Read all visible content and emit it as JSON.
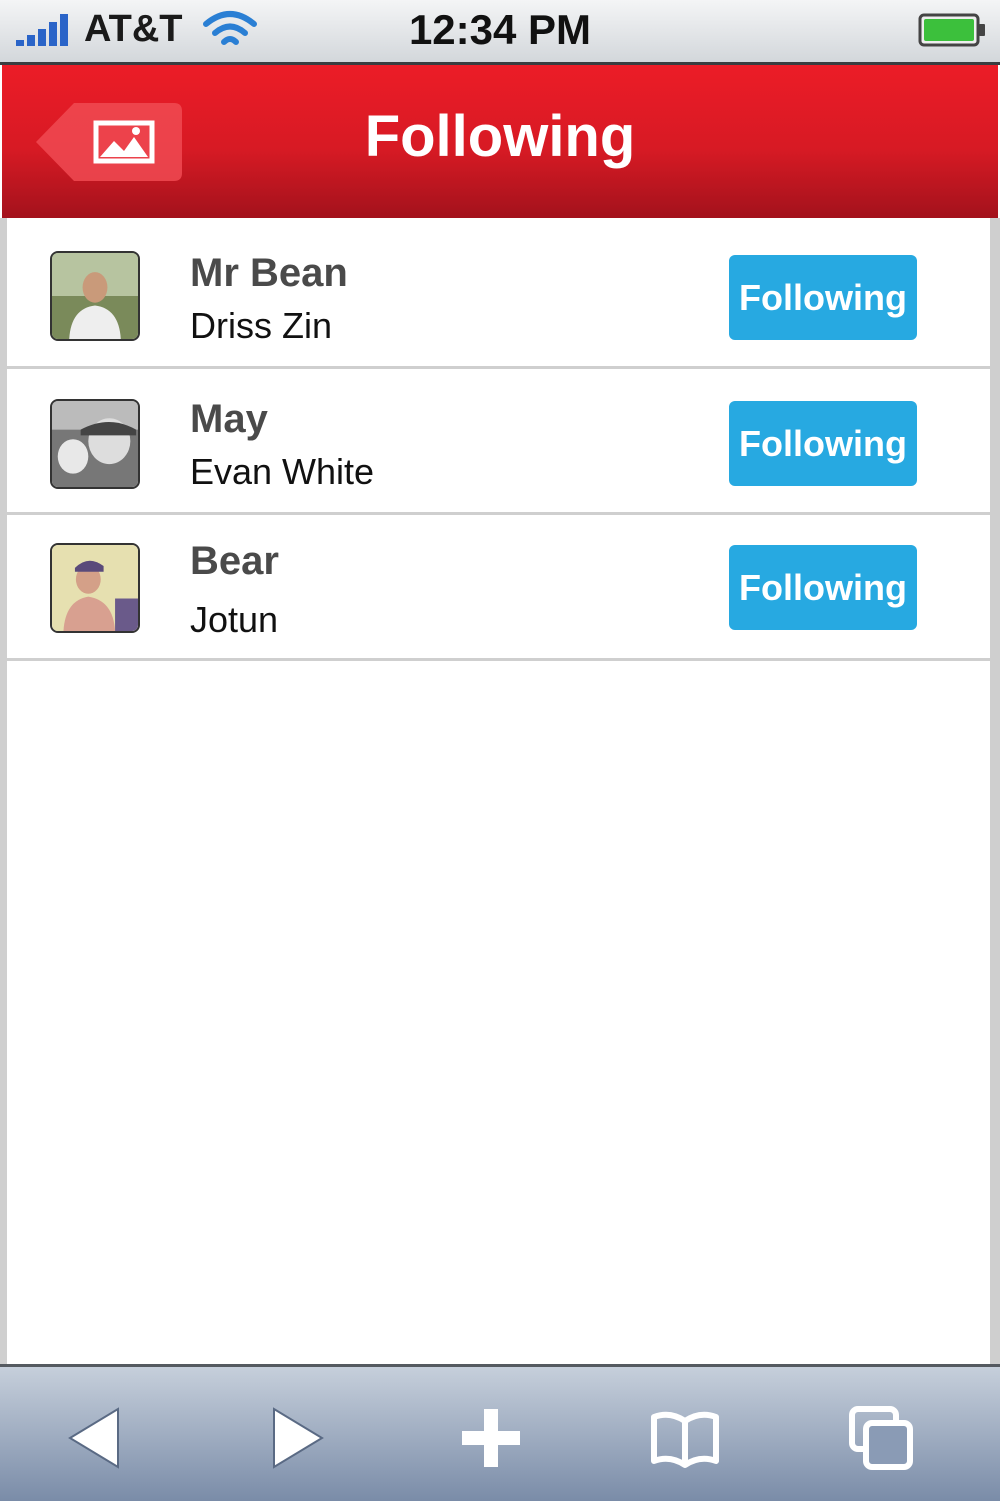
{
  "status_bar": {
    "carrier": "AT&T",
    "time": "12:34 PM",
    "icons": [
      "signal-icon",
      "wifi-icon",
      "battery-icon"
    ]
  },
  "nav_bar": {
    "title": "Following",
    "back_icon": "image-icon",
    "background_color": "#e31b23"
  },
  "list": {
    "items": [
      {
        "name": "Mr Bean",
        "subtitle": "Driss Zin",
        "button_label": "Following"
      },
      {
        "name": "May",
        "subtitle": "Evan White",
        "button_label": "Following"
      },
      {
        "name": "Bear",
        "subtitle": "Jotun",
        "button_label": "Following"
      }
    ],
    "button_color": "#27a9e1"
  },
  "toolbar": {
    "icons": [
      "back-arrow-icon",
      "forward-arrow-icon",
      "plus-icon",
      "bookmarks-icon",
      "pages-icon"
    ]
  }
}
